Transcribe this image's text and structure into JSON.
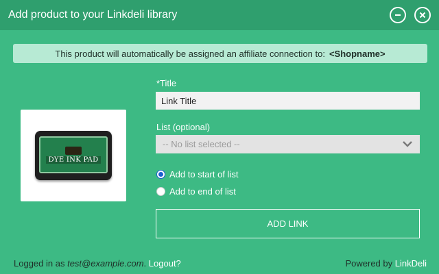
{
  "header": {
    "title": "Add product to your Linkdeli library",
    "icons": [
      "minimize-icon",
      "close-icon"
    ]
  },
  "banner": {
    "text": "This product will automatically be assigned an affiliate connection to:",
    "shop": "<Shopname>"
  },
  "product": {
    "image_text": "DYE INK PAD"
  },
  "form": {
    "title_label": "*Title",
    "title_value": "Link Title",
    "list_label": "List (optional)",
    "list_selected": "-- No list selected --",
    "radio_start_label": "Add to start of list",
    "radio_end_label": "Add to end of list",
    "radio_selected": "start",
    "submit_label": "ADD LINK"
  },
  "footer": {
    "logged_in_prefix": "Logged in as",
    "email": "test@example.com",
    "separator": ".",
    "logout": "Logout?",
    "powered_by": "Powered by",
    "brand": "LinkDeli"
  },
  "colors": {
    "background": "#3dba84",
    "header": "#2f9f6e",
    "banner": "#b7ead4",
    "radio_accent": "#1a5fd0"
  }
}
